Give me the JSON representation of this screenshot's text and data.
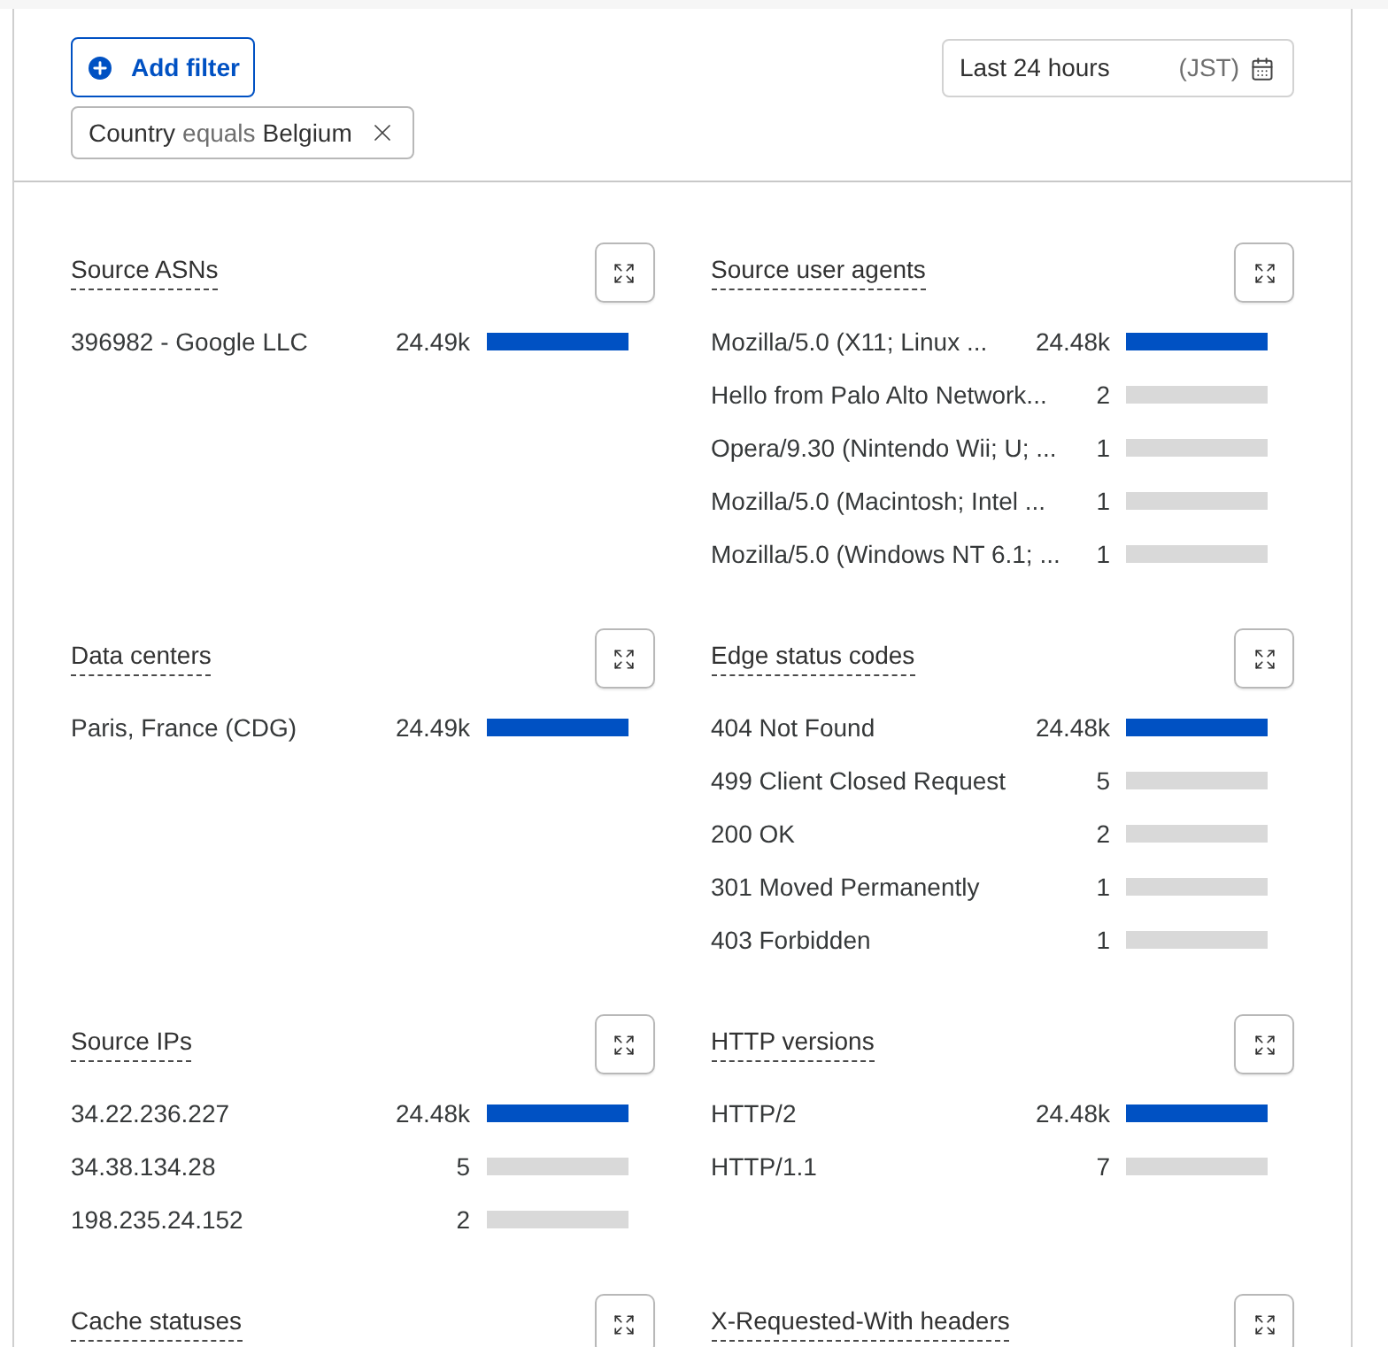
{
  "filters_bar": {
    "add_filter_button": "Add filter",
    "active_filters": [
      {
        "field": "Country",
        "operator": "equals",
        "value": "Belgium"
      }
    ],
    "time_range": {
      "value": "Last 24 hours",
      "timezone": "(JST)"
    }
  },
  "panels": [
    {
      "title": "Source ASNs",
      "rows": [
        {
          "label": "396982 - Google LLC",
          "count": "24.49k",
          "level": 1
        }
      ]
    },
    {
      "title": "Source user agents",
      "rows": [
        {
          "label": "Mozilla/5.0 (X11; Linux ...",
          "count": "24.48k",
          "level": 1
        },
        {
          "label": "Hello from Palo Alto Network...",
          "count": "2"
        },
        {
          "label": "Opera/9.30 (Nintendo Wii; U; ...",
          "count": "1"
        },
        {
          "label": "Mozilla/5.0 (Macintosh; Intel ...",
          "count": "1"
        },
        {
          "label": "Mozilla/5.0 (Windows NT 6.1; ...",
          "count": "1"
        }
      ]
    },
    {
      "title": "Data centers",
      "rows": [
        {
          "label": "Paris, France (CDG)",
          "count": "24.49k",
          "level": 1
        }
      ]
    },
    {
      "title": "Edge status codes",
      "rows": [
        {
          "label": "404 Not Found",
          "count": "24.48k",
          "level": 1
        },
        {
          "label": "499 Client Closed Request",
          "count": "5"
        },
        {
          "label": "200 OK",
          "count": "2"
        },
        {
          "label": "301 Moved Permanently",
          "count": "1"
        },
        {
          "label": "403 Forbidden",
          "count": "1"
        }
      ]
    },
    {
      "title": "Source IPs",
      "rows": [
        {
          "label": "34.22.236.227",
          "count": "24.48k",
          "level": 1
        },
        {
          "label": "34.38.134.28",
          "count": "5"
        },
        {
          "label": "198.235.24.152",
          "count": "2"
        }
      ]
    },
    {
      "title": "HTTP versions",
      "rows": [
        {
          "label": "HTTP/2",
          "count": "24.48k",
          "level": 1
        },
        {
          "label": "HTTP/1.1",
          "count": "7"
        }
      ]
    },
    {
      "title": "Cache statuses"
    },
    {
      "title": "X-Requested-With headers"
    }
  ]
}
